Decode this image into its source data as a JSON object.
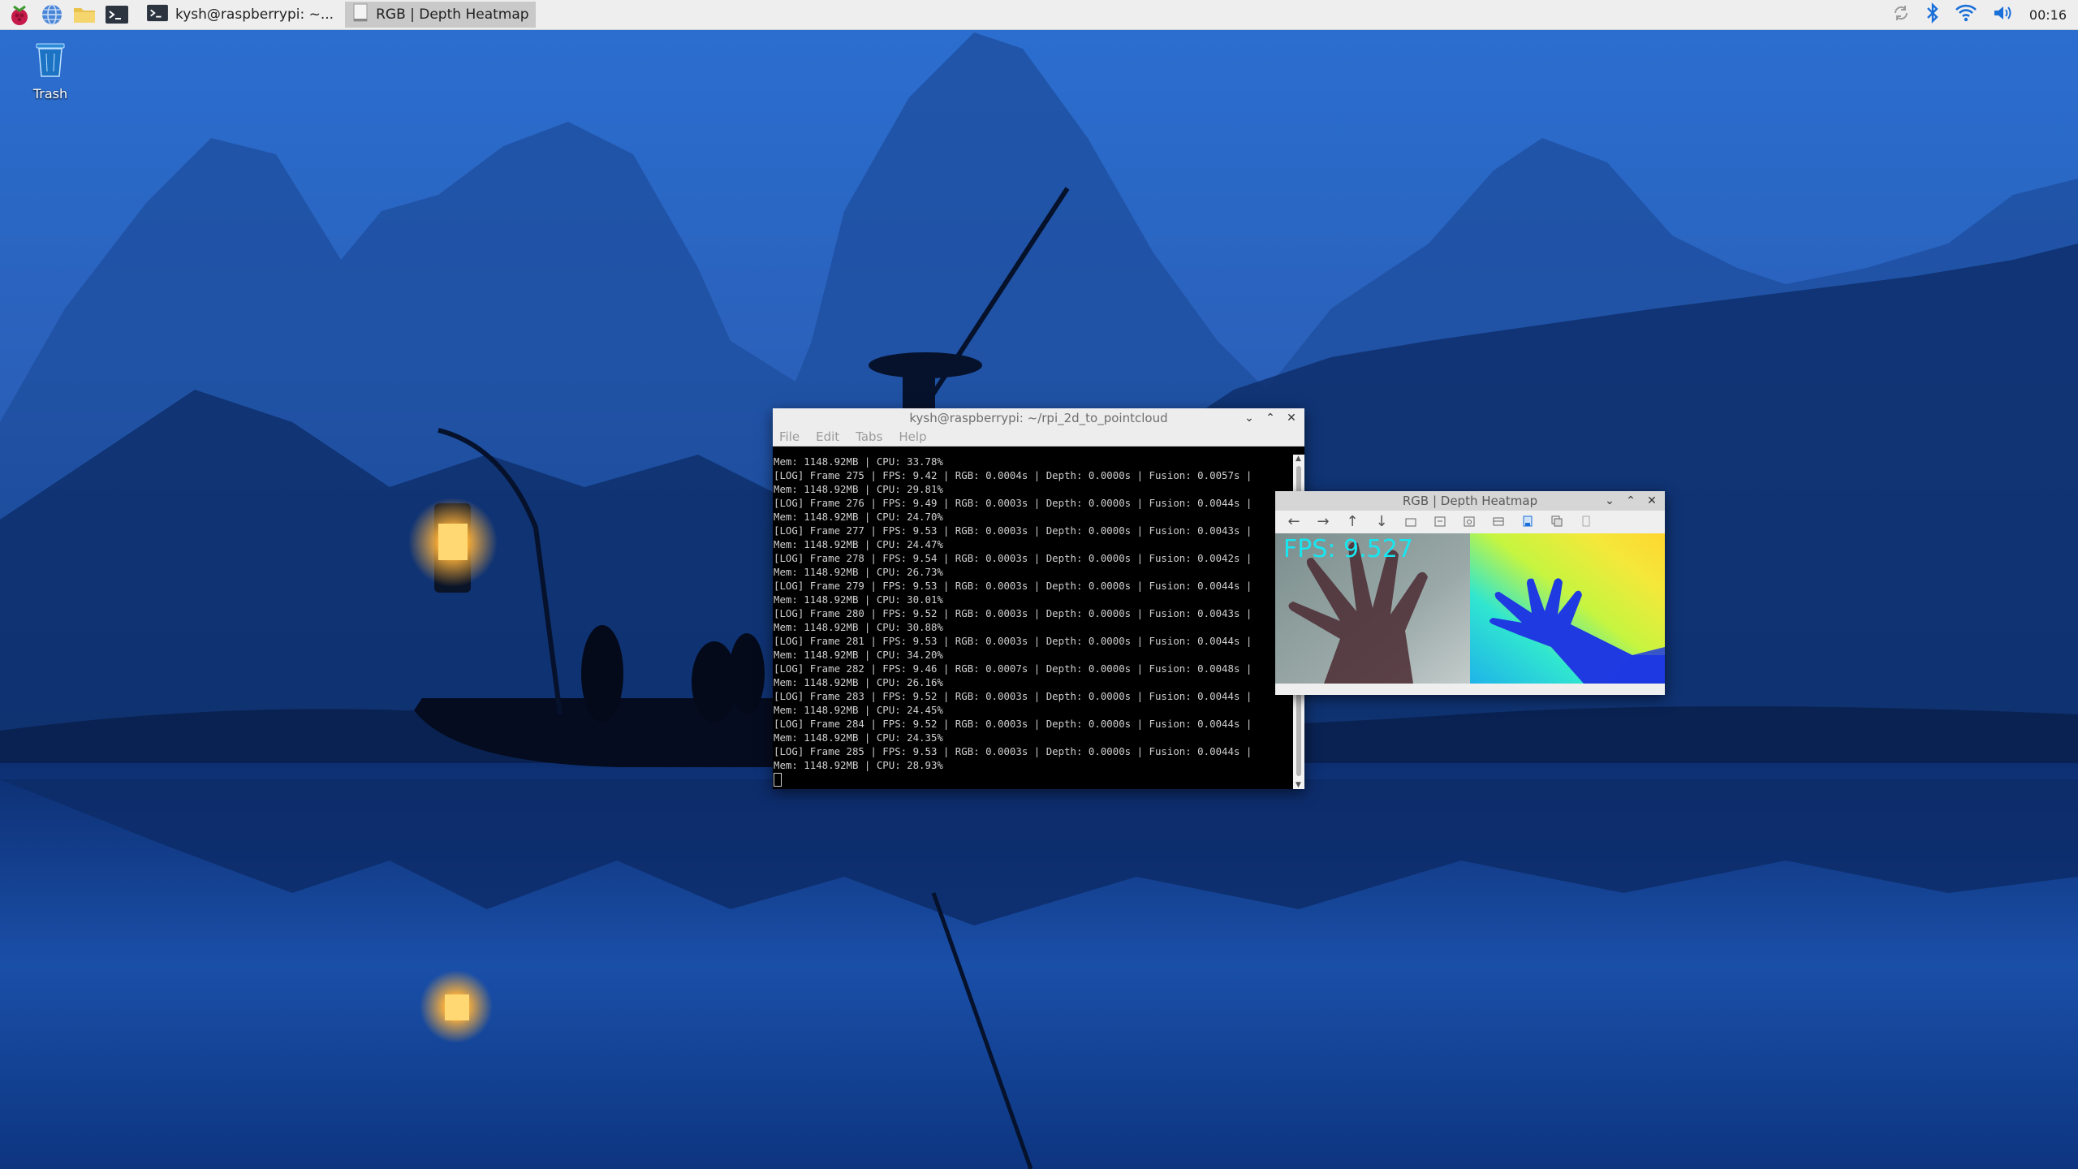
{
  "taskbar": {
    "launchers": [
      "raspberry-menu-icon",
      "browser-globe-icon",
      "file-manager-folder-icon",
      "terminal-icon"
    ],
    "tasks": [
      {
        "label": "kysh@raspberrypi: ~...",
        "icon": "terminal-icon",
        "active": false
      },
      {
        "label": "RGB | Depth Heatmap",
        "icon": "window-icon",
        "active": true
      }
    ],
    "tray": {
      "icons": [
        "update-sync-icon",
        "bluetooth-icon",
        "wifi-icon",
        "volume-icon"
      ],
      "clock": "00:16"
    }
  },
  "desktop": {
    "icons": [
      {
        "label": "Trash",
        "icon": "trash-icon"
      }
    ]
  },
  "terminal": {
    "title": "kysh@raspberrypi: ~/rpi_2d_to_pointcloud",
    "menu": [
      "File",
      "Edit",
      "Tabs",
      "Help"
    ],
    "lines": [
      "Mem: 1148.92MB | CPU: 33.78%",
      "[LOG] Frame 275 | FPS: 9.42 | RGB: 0.0004s | Depth: 0.0000s | Fusion: 0.0057s |",
      "Mem: 1148.92MB | CPU: 29.81%",
      "[LOG] Frame 276 | FPS: 9.49 | RGB: 0.0003s | Depth: 0.0000s | Fusion: 0.0044s |",
      "Mem: 1148.92MB | CPU: 24.70%",
      "[LOG] Frame 277 | FPS: 9.53 | RGB: 0.0003s | Depth: 0.0000s | Fusion: 0.0043s |",
      "Mem: 1148.92MB | CPU: 24.47%",
      "[LOG] Frame 278 | FPS: 9.54 | RGB: 0.0003s | Depth: 0.0000s | Fusion: 0.0042s |",
      "Mem: 1148.92MB | CPU: 26.73%",
      "[LOG] Frame 279 | FPS: 9.53 | RGB: 0.0003s | Depth: 0.0000s | Fusion: 0.0044s |",
      "Mem: 1148.92MB | CPU: 30.01%",
      "[LOG] Frame 280 | FPS: 9.52 | RGB: 0.0003s | Depth: 0.0000s | Fusion: 0.0043s |",
      "Mem: 1148.92MB | CPU: 30.88%",
      "[LOG] Frame 281 | FPS: 9.53 | RGB: 0.0003s | Depth: 0.0000s | Fusion: 0.0044s |",
      "Mem: 1148.92MB | CPU: 34.20%",
      "[LOG] Frame 282 | FPS: 9.46 | RGB: 0.0007s | Depth: 0.0000s | Fusion: 0.0048s |",
      "Mem: 1148.92MB | CPU: 26.16%",
      "[LOG] Frame 283 | FPS: 9.52 | RGB: 0.0003s | Depth: 0.0000s | Fusion: 0.0044s |",
      "Mem: 1148.92MB | CPU: 24.45%",
      "[LOG] Frame 284 | FPS: 9.52 | RGB: 0.0003s | Depth: 0.0000s | Fusion: 0.0044s |",
      "Mem: 1148.92MB | CPU: 24.35%",
      "[LOG] Frame 285 | FPS: 9.53 | RGB: 0.0003s | Depth: 0.0000s | Fusion: 0.0044s |",
      "Mem: 1148.92MB | CPU: 28.93%"
    ]
  },
  "heatmap_window": {
    "title": "RGB | Depth Heatmap",
    "toolbar_icons": [
      "back-arrow-icon",
      "forward-arrow-icon",
      "up-arrow-icon",
      "down-arrow-icon",
      "home-icon",
      "pan-icon",
      "zoom-icon",
      "fit-icon",
      "save-icon",
      "copy-icon",
      "settings-icon"
    ],
    "fps_overlay": "FPS: 9.527"
  },
  "colors": {
    "taskbar_bg": "#eeeeee",
    "active_task_bg": "#c9c9c9",
    "terminal_bg": "#000000",
    "terminal_text": "#d0d0d0",
    "fps_overlay": "#18e6f0",
    "accent_blue": "#1a6fd8"
  }
}
